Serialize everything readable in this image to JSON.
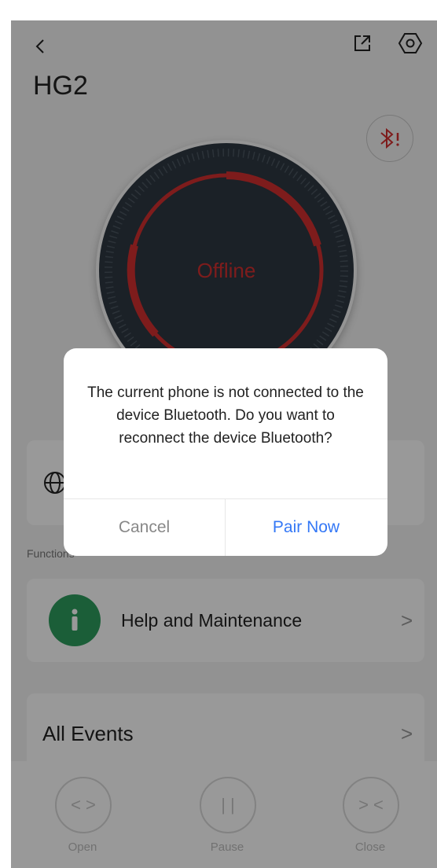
{
  "header": {
    "back_icon": "chevron-left-icon",
    "title": "HG2",
    "share_icon": "share-icon",
    "settings_icon": "settings-hex-icon"
  },
  "device": {
    "status": "Offline",
    "bluetooth_badge_icon": "bluetooth-warning-icon",
    "status_color": "#d2302f"
  },
  "network_card": {
    "icon": "globe-icon"
  },
  "functions": {
    "section_label": "Functions",
    "help": {
      "icon": "info-icon",
      "label": "Help and Maintenance",
      "chevron": ">"
    }
  },
  "events": {
    "label": "All Events",
    "chevron": ">"
  },
  "controls": {
    "open": {
      "glyph": "< >",
      "label": "Open"
    },
    "pause": {
      "glyph": "| |",
      "label": "Pause"
    },
    "close": {
      "glyph": "> <",
      "label": "Close"
    }
  },
  "dialog": {
    "message": "The current phone is not connected to the device Bluetooth. Do you want to reconnect the device Bluetooth?",
    "cancel_label": "Cancel",
    "confirm_label": "Pair Now",
    "accent_color": "#3478f6"
  }
}
